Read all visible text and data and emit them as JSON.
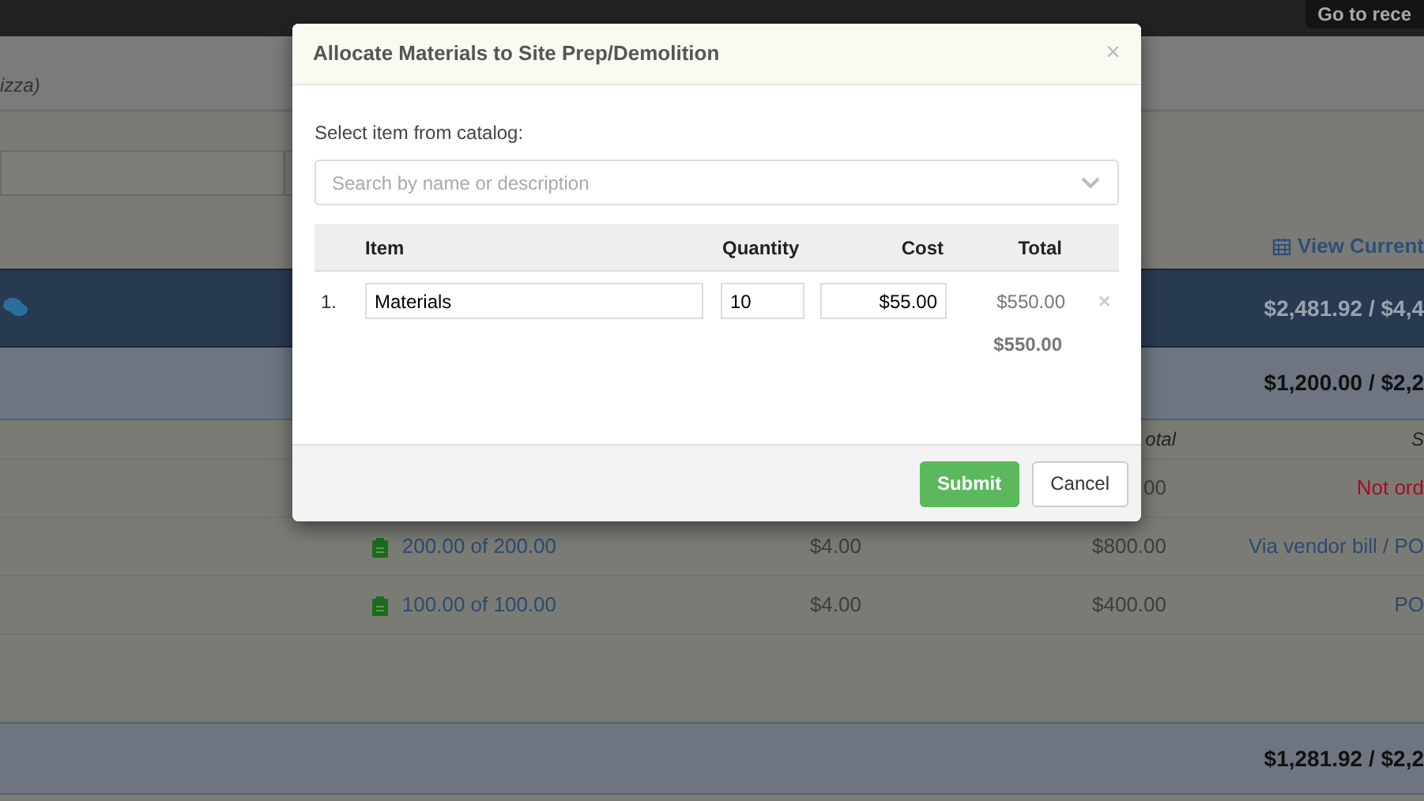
{
  "top_bar": {
    "button": "Go to rece"
  },
  "page": {
    "subtitle": "izza)",
    "view_link": "View Current",
    "phase_total": "$2,481.92 / $4,4",
    "group_total": "$1,200.00 / $2,2",
    "columns": [
      "otal",
      "S"
    ],
    "rows": [
      {
        "quantity": null,
        "cost": null,
        "total": "00",
        "status": "Not ord",
        "kind": "alert"
      },
      {
        "quantity": "200.00 of 200.00",
        "cost": "$4.00",
        "total": "$800.00",
        "status": "Via vendor bill / PO",
        "kind": "link"
      },
      {
        "quantity": "100.00 of 100.00",
        "cost": "$4.00",
        "total": "$400.00",
        "status": "PO",
        "kind": "link"
      }
    ],
    "footer_total": "$1,281.92 / $2,2"
  },
  "modal": {
    "title": "Allocate Materials to Site Prep/Demolition",
    "close": "×",
    "catalog_label": "Select item from catalog:",
    "search": {
      "placeholder": "Search by name or description"
    },
    "columns": [
      "Item",
      "Quantity",
      "Cost",
      "Total"
    ],
    "items": [
      {
        "number": "1.",
        "item": "Materials",
        "quantity": "10",
        "cost": "$55.00",
        "total": "$550.00",
        "remove": "×"
      }
    ],
    "sum": "$550.00",
    "buttons": [
      "Submit",
      "Cancel"
    ]
  }
}
